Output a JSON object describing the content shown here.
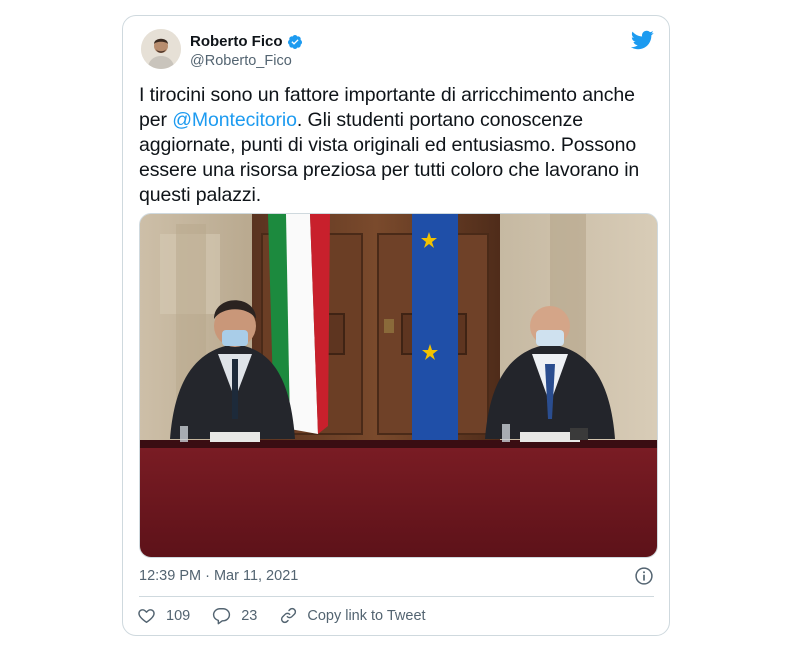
{
  "tweet": {
    "author": {
      "name": "Roberto Fico",
      "handle": "@Roberto_Fico",
      "verified": true
    },
    "text": {
      "part1": "I tirocini sono un fattore importante di arricchimento anche per ",
      "mention": "@Montecitorio",
      "part2": ". Gli studenti portano conoscenze aggiornate, punti di vista originali ed entusiasmo. Possono essere una risorsa preziosa per tutti coloro che lavorano in questi palazzi."
    },
    "timestamp": "12:39 PM · Mar 11, 2021",
    "actions": {
      "likes": "109",
      "replies": "23",
      "share_label": "Copy link to Tweet"
    }
  },
  "colors": {
    "brand": "#1d9bf0",
    "text": "#0f1419",
    "muted": "#536471",
    "border": "#cfd9de"
  },
  "icons": [
    "twitter-logo-icon",
    "verified-badge-icon",
    "info-icon",
    "heart-icon",
    "reply-icon",
    "link-icon"
  ]
}
